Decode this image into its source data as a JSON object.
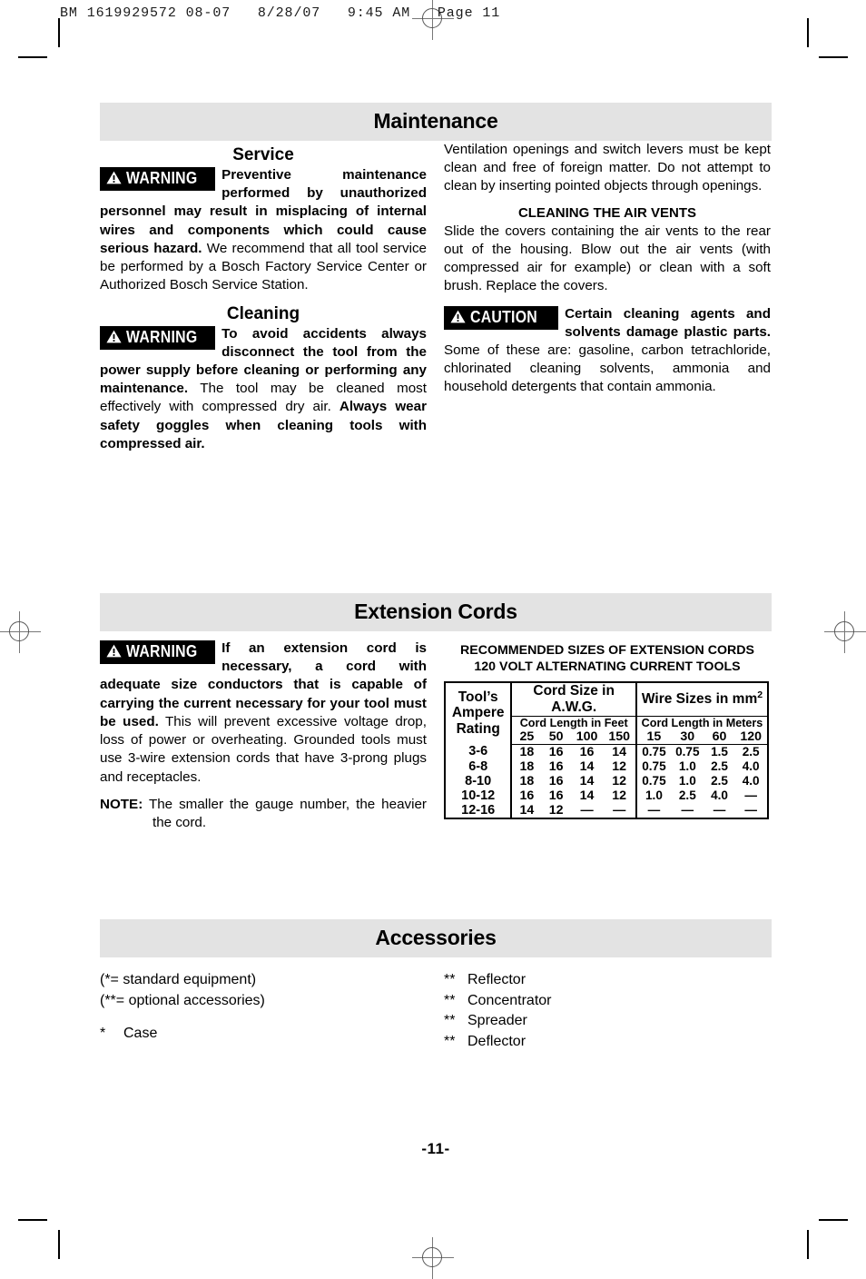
{
  "slug": "BM 1619929572 08-07   8/28/07   9:45 AM   Page 11",
  "page_number": "-11-",
  "maintenance": {
    "section_title": "Maintenance",
    "service": {
      "heading": "Service",
      "warning_label": "WARNING",
      "warning_bold": "Preventive maintenance performed by unauthorized personnel may result in misplacing of internal wires and components which could cause serious hazard.",
      "warning_rest": " We recommend that all tool service be performed by a Bosch Factory Service Center or Authorized Bosch Service Station."
    },
    "cleaning": {
      "heading": "Cleaning",
      "warning_label": "WARNING",
      "warning_bold": "To avoid accidents always disconnect the tool from the power supply before cleaning or performing any maintenance.",
      "warning_rest": " The tool may be cleaned most effectively with compressed dry air. ",
      "warning_bold2": "Always wear safety goggles when cleaning tools with compressed air."
    },
    "ventilation_paragraph": "Ventilation openings and switch levers must be kept clean and free of foreign matter. Do not attempt to clean by inserting pointed objects through openings.",
    "air_vents": {
      "heading": "CLEANING THE AIR VENTS",
      "paragraph": "Slide the covers containing the air vents to the rear out of the housing. Blow out the air vents (with compressed air for example) or clean with a soft brush.  Replace the covers."
    },
    "caution": {
      "caution_label": "CAUTION",
      "caution_bold": "Certain cleaning agents and solvents damage plastic parts.",
      "caution_rest": " Some of these are: gasoline, carbon tetrachloride, chlorinated cleaning solvents, ammonia and household detergents that contain ammonia."
    }
  },
  "extension_cords": {
    "section_title": "Extension Cords",
    "warning_label": "WARNING",
    "warning_bold": "If an extension cord is necessary, a cord with adequate size conductors that is capable of carrying the current necessary for your tool must be used.",
    "warning_rest": " This will prevent excessive voltage drop, loss of power or overheating. Grounded tools must use 3-wire extension cords that have 3-prong plugs and receptacles.",
    "note_label": "NOTE:",
    "note_text": " The smaller the gauge number, the heavier the cord.",
    "table": {
      "title_line1": "RECOMMENDED SIZES OF EXTENSION CORDS",
      "title_line2": "120 VOLT ALTERNATING CURRENT TOOLS",
      "row_header_line1": "Tool’s",
      "row_header_line2": "Ampere",
      "row_header_line3": "Rating",
      "group_awg": "Cord Size in A.W.G.",
      "group_mm": "Wire Sizes in mm",
      "group_mm_sup": "2",
      "sub_feet": "Cord Length in Feet",
      "sub_meters": "Cord Length in Meters",
      "feet_headers": [
        "25",
        "50",
        "100",
        "150"
      ],
      "meter_headers": [
        "15",
        "30",
        "60",
        "120"
      ],
      "rows": [
        {
          "rating": "3-6",
          "awg": [
            "18",
            "16",
            "16",
            "14"
          ],
          "mm": [
            "0.75",
            "0.75",
            "1.5",
            "2.5"
          ]
        },
        {
          "rating": "6-8",
          "awg": [
            "18",
            "16",
            "14",
            "12"
          ],
          "mm": [
            "0.75",
            "1.0",
            "2.5",
            "4.0"
          ]
        },
        {
          "rating": "8-10",
          "awg": [
            "18",
            "16",
            "14",
            "12"
          ],
          "mm": [
            "0.75",
            "1.0",
            "2.5",
            "4.0"
          ]
        },
        {
          "rating": "10-12",
          "awg": [
            "16",
            "16",
            "14",
            "12"
          ],
          "mm": [
            "1.0",
            "2.5",
            "4.0",
            "—"
          ]
        },
        {
          "rating": "12-16",
          "awg": [
            "14",
            "12",
            "—",
            "—"
          ],
          "mm": [
            "—",
            "—",
            "—",
            "—"
          ]
        }
      ]
    }
  },
  "accessories": {
    "section_title": "Accessories",
    "legend_line1": "(*= standard equipment)",
    "legend_line2": "(**= optional accessories)",
    "left_items": [
      {
        "star": "*",
        "label": "Case"
      }
    ],
    "right_items": [
      {
        "star": "**",
        "label": "Reflector"
      },
      {
        "star": "**",
        "label": "Concentrator"
      },
      {
        "star": "**",
        "label": "Spreader"
      },
      {
        "star": "**",
        "label": "Deflector"
      }
    ]
  },
  "colors": {
    "section_bar": "#e3e3e3",
    "badge_bg": "#000000",
    "text": "#000000"
  }
}
